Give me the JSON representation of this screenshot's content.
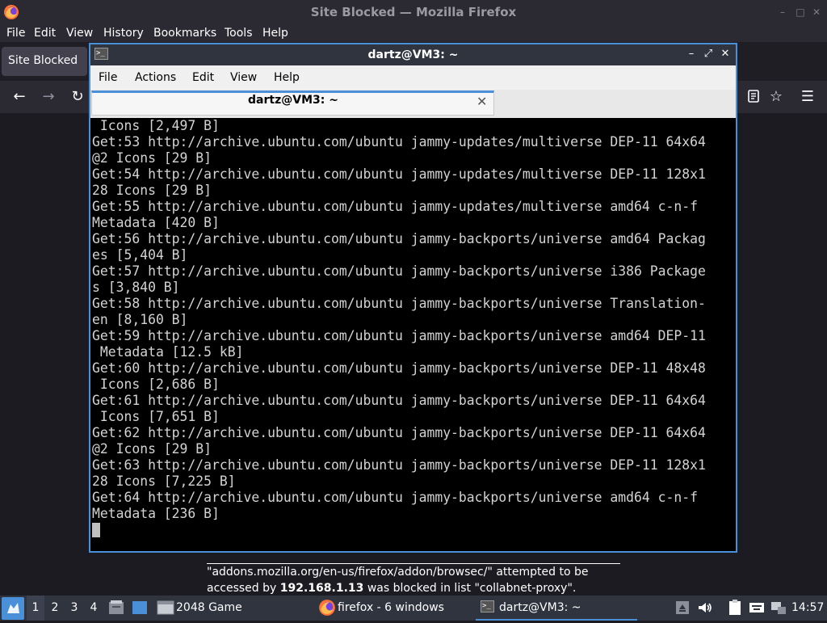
{
  "firefox": {
    "window_title": "Site Blocked — Mozilla Firefox",
    "menu": [
      "File",
      "Edit",
      "View",
      "History",
      "Bookmarks",
      "Tools",
      "Help"
    ],
    "tab_title": "Site Blocked"
  },
  "terminal": {
    "window_title": "dartz@VM3: ~",
    "menu": [
      "File",
      "Actions",
      "Edit",
      "View",
      "Help"
    ],
    "tab_title": "dartz@VM3: ~",
    "lines": [
      " Icons [2,497 B]",
      "Get:53 http://archive.ubuntu.com/ubuntu jammy-updates/multiverse DEP-11 64x64",
      "@2 Icons [29 B]",
      "Get:54 http://archive.ubuntu.com/ubuntu jammy-updates/multiverse DEP-11 128x1",
      "28 Icons [29 B]",
      "Get:55 http://archive.ubuntu.com/ubuntu jammy-updates/multiverse amd64 c-n-f",
      "Metadata [420 B]",
      "Get:56 http://archive.ubuntu.com/ubuntu jammy-backports/universe amd64 Packag",
      "es [5,404 B]",
      "Get:57 http://archive.ubuntu.com/ubuntu jammy-backports/universe i386 Package",
      "s [3,840 B]",
      "Get:58 http://archive.ubuntu.com/ubuntu jammy-backports/universe Translation-",
      "en [8,160 B]",
      "Get:59 http://archive.ubuntu.com/ubuntu jammy-backports/universe amd64 DEP-11",
      " Metadata [12.5 kB]",
      "Get:60 http://archive.ubuntu.com/ubuntu jammy-backports/universe DEP-11 48x48",
      " Icons [2,686 B]",
      "Get:61 http://archive.ubuntu.com/ubuntu jammy-backports/universe DEP-11 64x64",
      " Icons [7,651 B]",
      "Get:62 http://archive.ubuntu.com/ubuntu jammy-backports/universe DEP-11 64x64",
      "@2 Icons [29 B]",
      "Get:63 http://archive.ubuntu.com/ubuntu jammy-backports/universe DEP-11 128x1",
      "28 Icons [7,225 B]",
      "Get:64 http://archive.ubuntu.com/ubuntu jammy-backports/universe amd64 c-n-f",
      "Metadata [236 B]"
    ]
  },
  "notification": {
    "line1": "\"addons.mozilla.org/en-us/firefox/addon/browsec/\" attempted to be",
    "line2_prefix": "accessed by ",
    "line2_ip": "192.168.1.13",
    "line2_suffix": " was blocked in list \"collabnet-proxy\"."
  },
  "taskbar": {
    "workspaces": [
      "1",
      "2",
      "3",
      "4"
    ],
    "tasks": {
      "game": "2048 Game",
      "firefox": "firefox - 6 windows",
      "terminal": "dartz@VM3: ~"
    },
    "clock": "14:57"
  }
}
